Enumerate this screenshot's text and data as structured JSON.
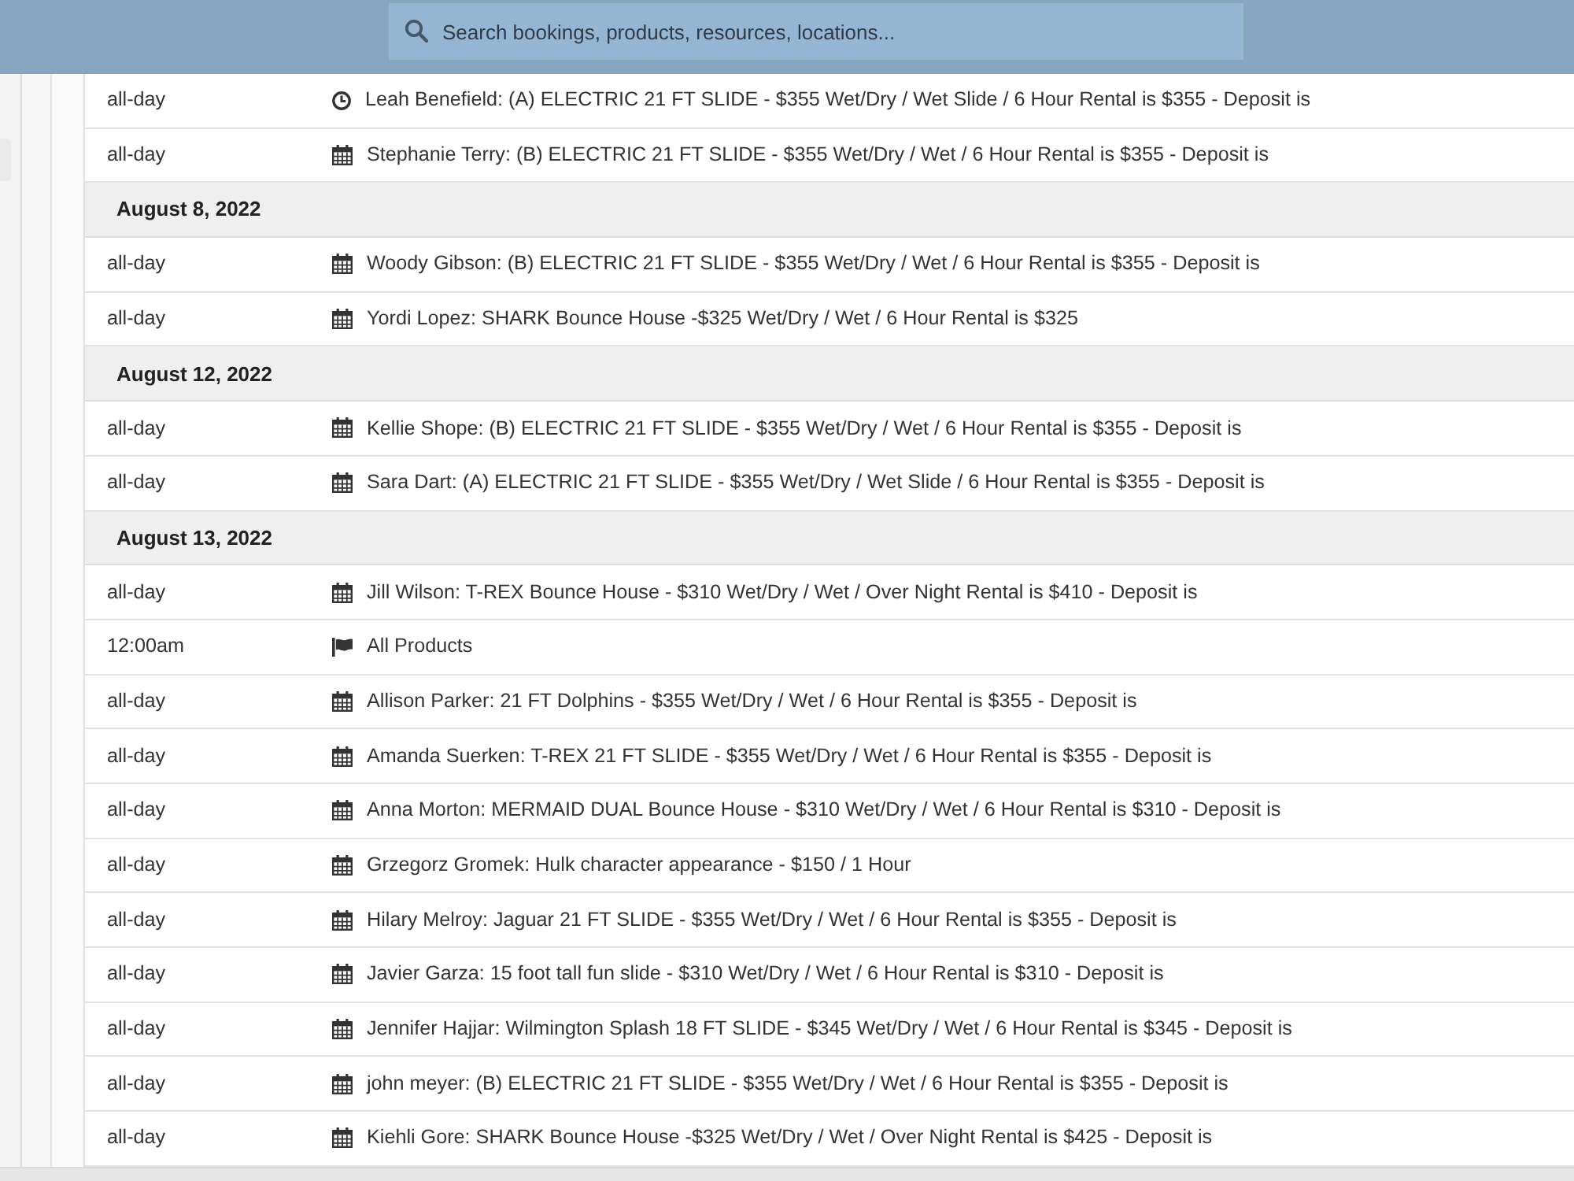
{
  "search": {
    "placeholder": "Search bookings, products, resources, locations..."
  },
  "agenda": [
    {
      "kind": "clock",
      "time": "all-day",
      "title": "Leah Benefield: (A) ELECTRIC 21 FT SLIDE - $355 Wet/Dry / Wet Slide / 6 Hour Rental is $355 - Deposit is"
    },
    {
      "kind": "calendar",
      "time": "all-day",
      "title": "Stephanie Terry: (B) ELECTRIC 21 FT SLIDE - $355 Wet/Dry / Wet / 6 Hour Rental is $355 - Deposit is"
    },
    {
      "kind": "date",
      "label": "August 8, 2022"
    },
    {
      "kind": "calendar",
      "time": "all-day",
      "title": "Woody Gibson: (B) ELECTRIC 21 FT SLIDE - $355 Wet/Dry / Wet / 6 Hour Rental is $355 - Deposit is"
    },
    {
      "kind": "calendar",
      "time": "all-day",
      "title": "Yordi Lopez: SHARK Bounce House -$325 Wet/Dry / Wet / 6 Hour Rental is $325"
    },
    {
      "kind": "date",
      "label": "August 12, 2022"
    },
    {
      "kind": "calendar",
      "time": "all-day",
      "title": "Kellie Shope: (B) ELECTRIC 21 FT SLIDE - $355 Wet/Dry / Wet / 6 Hour Rental is $355 - Deposit is"
    },
    {
      "kind": "calendar",
      "time": "all-day",
      "title": "Sara Dart: (A) ELECTRIC 21 FT SLIDE - $355 Wet/Dry / Wet Slide / 6 Hour Rental is $355 - Deposit is"
    },
    {
      "kind": "date",
      "label": "August 13, 2022"
    },
    {
      "kind": "calendar",
      "time": "all-day",
      "title": "Jill Wilson: T-REX Bounce House - $310 Wet/Dry / Wet / Over Night Rental is $410 - Deposit is"
    },
    {
      "kind": "flag",
      "time": "12:00am",
      "title": "All Products"
    },
    {
      "kind": "calendar",
      "time": "all-day",
      "title": "Allison Parker: 21 FT Dolphins - $355 Wet/Dry / Wet / 6 Hour Rental is $355 - Deposit is"
    },
    {
      "kind": "calendar",
      "time": "all-day",
      "title": "Amanda Suerken: T-REX 21 FT SLIDE - $355 Wet/Dry / Wet / 6 Hour Rental is $355 - Deposit is"
    },
    {
      "kind": "calendar",
      "time": "all-day",
      "title": "Anna Morton: MERMAID DUAL Bounce House - $310 Wet/Dry / Wet / 6 Hour Rental is $310 - Deposit is"
    },
    {
      "kind": "calendar",
      "time": "all-day",
      "title": "Grzegorz Gromek: Hulk character appearance - $150 / 1 Hour"
    },
    {
      "kind": "calendar",
      "time": "all-day",
      "title": "Hilary Melroy: Jaguar 21 FT SLIDE - $355 Wet/Dry / Wet / 6 Hour Rental is $355 - Deposit is"
    },
    {
      "kind": "calendar",
      "time": "all-day",
      "title": "Javier Garza: 15 foot tall fun slide - $310 Wet/Dry / Wet / 6 Hour Rental is $310 - Deposit is"
    },
    {
      "kind": "calendar",
      "time": "all-day",
      "title": "Jennifer Hajjar: Wilmington Splash 18 FT SLIDE - $345 Wet/Dry / Wet / 6 Hour Rental is $345 - Deposit is"
    },
    {
      "kind": "calendar",
      "time": "all-day",
      "title": "john meyer: (B) ELECTRIC 21 FT SLIDE - $355 Wet/Dry / Wet / 6 Hour Rental is $355 - Deposit is"
    },
    {
      "kind": "calendar",
      "time": "all-day",
      "title": "Kiehli Gore: SHARK Bounce House -$325 Wet/Dry / Wet / Over Night Rental is $425 - Deposit is"
    }
  ]
}
